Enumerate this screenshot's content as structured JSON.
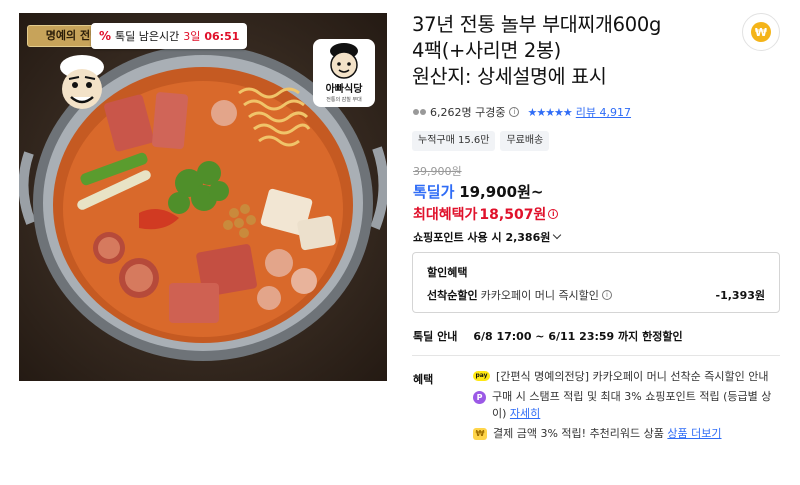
{
  "image": {
    "hall_badge": "명예의 전당",
    "timer": {
      "icon": "percent-icon",
      "label": "톡딜 남은시간",
      "days": "3일",
      "time": "06:51"
    },
    "brand_logo": {
      "name": "아빠식당",
      "sub": "전통의 감칠 부대"
    }
  },
  "product": {
    "title_line1": "37년 전통 놀부 부대찌개600g",
    "title_line2": "4팩(+사리면 2봉)",
    "title_line3": "원산지: 상세설명에 표시",
    "coin_symbol": "₩"
  },
  "stats": {
    "watchers": "6,262명 구경중",
    "stars": "★★★★★",
    "review_label": "리뷰",
    "review_count": "4,917"
  },
  "chips": [
    "누적구매 15.6만",
    "무료배송"
  ],
  "price": {
    "original": "39,900원",
    "deal_label": "톡딜가",
    "deal_amount": "19,900원~",
    "max_label": "최대혜택가",
    "max_amount": "18,507원",
    "points": "쇼핑포인트 사용 시 2,386원"
  },
  "discount": {
    "title": "할인혜택",
    "row_name": "선착순할인",
    "row_desc": "카카오페이 머니 즉시할인",
    "row_amount": "-1,393원"
  },
  "deal_info": {
    "label": "톡딜 안내",
    "period": "6/8 17:00 ~ 6/11 23:59 까지 한정할인"
  },
  "benefits": {
    "label": "혜택",
    "items": [
      {
        "icon": "kakaopay-icon",
        "icon_text": "pay",
        "text": "[간편식 명예의전당] 카카오페이 머니 선착순 즉시할인 안내"
      },
      {
        "icon": "point-icon",
        "icon_text": "P",
        "text": "구매 시 스탬프 적립 및 최대 3% 쇼핑포인트 적립 (등급별 상이)",
        "link": "자세히"
      },
      {
        "icon": "chip-icon",
        "icon_text": "₩",
        "text": "결제 금액 3% 적립! 추천리워드 상품",
        "link": "상품 더보기"
      }
    ]
  },
  "colors": {
    "accent_blue": "#2f6cf6",
    "accent_red": "#e0112b",
    "badge_gold": "#c7a35a"
  }
}
